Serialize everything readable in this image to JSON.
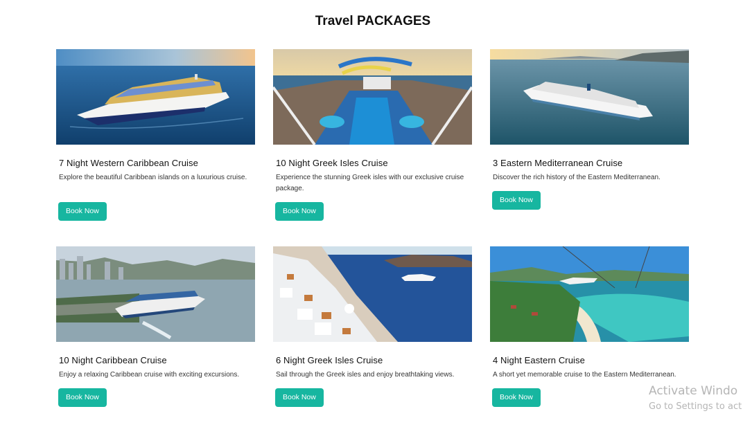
{
  "page": {
    "title": "Travel PACKAGES"
  },
  "packages": [
    {
      "title": "7 Night Western Caribbean Cruise",
      "description": "Explore the beautiful Caribbean islands on a luxurious cruise.",
      "button_label": "Book Now",
      "image": "large-cruise-ship-open-sea"
    },
    {
      "title": "10 Night Greek Isles Cruise",
      "description": "Experience the stunning Greek isles with our exclusive cruise package.",
      "button_label": "Book Now",
      "image": "cruise-ship-pool-deck-sunset"
    },
    {
      "title": "3 Eastern Mediterranean Cruise",
      "description": "Discover the rich history of the Eastern Mediterranean.",
      "button_label": "Book Now",
      "image": "cruise-ship-near-coast-sunset"
    },
    {
      "title": "10 Night Caribbean Cruise",
      "description": "Enjoy a relaxing Caribbean cruise with exciting excursions.",
      "button_label": "Book Now",
      "image": "cruise-ship-city-harbor"
    },
    {
      "title": "6 Night Greek Isles Cruise",
      "description": "Sail through the Greek isles and enjoy breathtaking views.",
      "button_label": "Book Now",
      "image": "santorini-cliffs-cruise-ship"
    },
    {
      "title": "4 Night Eastern Cruise",
      "description": "A short yet memorable cruise to the Eastern Mediterranean.",
      "button_label": "Book Now",
      "image": "tropical-beach-zipline"
    }
  ],
  "watermark": {
    "line1": "Activate Windo",
    "line2": "Go to Settings to act"
  }
}
